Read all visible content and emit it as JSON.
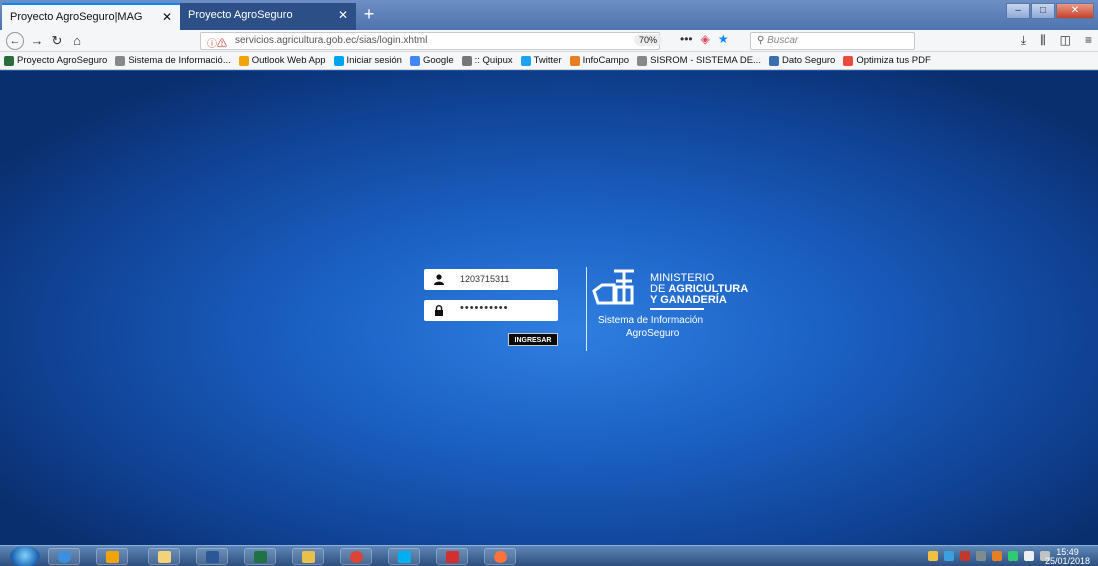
{
  "browser": {
    "tabs": [
      {
        "label": "Proyecto AgroSeguro|MAG",
        "active": true
      },
      {
        "label": "Proyecto AgroSeguro",
        "active": false
      }
    ],
    "new_tab_label": "+",
    "close_label": "✕",
    "url_domain": "servicios.agricultura.gob.ec",
    "url_path": "/sias/login.xhtml",
    "zoom": "70%",
    "search_placeholder": "Buscar",
    "bookmarks": [
      {
        "label": "Proyecto AgroSeguro",
        "icon": "ministry-flag-icon",
        "color": "#2b6c3f"
      },
      {
        "label": "Sistema de Informació...",
        "icon": "globe-icon",
        "color": "#888888"
      },
      {
        "label": "Outlook Web App",
        "icon": "outlook-icon",
        "color": "#f0a30a"
      },
      {
        "label": "Iniciar sesión",
        "icon": "windows-icon",
        "color": "#00a4ef"
      },
      {
        "label": "Google",
        "icon": "google-icon",
        "color": "#4285f4"
      },
      {
        "label": ":: Quipux",
        "icon": "quipux-icon",
        "color": "#777777"
      },
      {
        "label": "Twitter",
        "icon": "twitter-icon",
        "color": "#1da1f2"
      },
      {
        "label": "InfoCampo",
        "icon": "infocampo-icon",
        "color": "#e67e22"
      },
      {
        "label": "SISROM - SISTEMA DE...",
        "icon": "globe-icon",
        "color": "#888888"
      },
      {
        "label": "Dato Seguro",
        "icon": "dato-seguro-icon",
        "color": "#3a6fb0"
      },
      {
        "label": "Optimiza tus PDF",
        "icon": "heart-icon",
        "color": "#e74c3c"
      }
    ]
  },
  "login": {
    "username_value": "1203715311",
    "password_mask": "••••••••••",
    "submit_label": "INGRESAR"
  },
  "brand": {
    "line1": "MINISTERIO",
    "line2_prefix": "DE",
    "line2_bold": "AGRICULTURA",
    "line3": "Y GANADERÍA",
    "system_line1": "Sistema de Información",
    "system_line2": "AgroSeguro"
  },
  "taskbar": {
    "time": "15:49",
    "date": "25/01/2018"
  }
}
